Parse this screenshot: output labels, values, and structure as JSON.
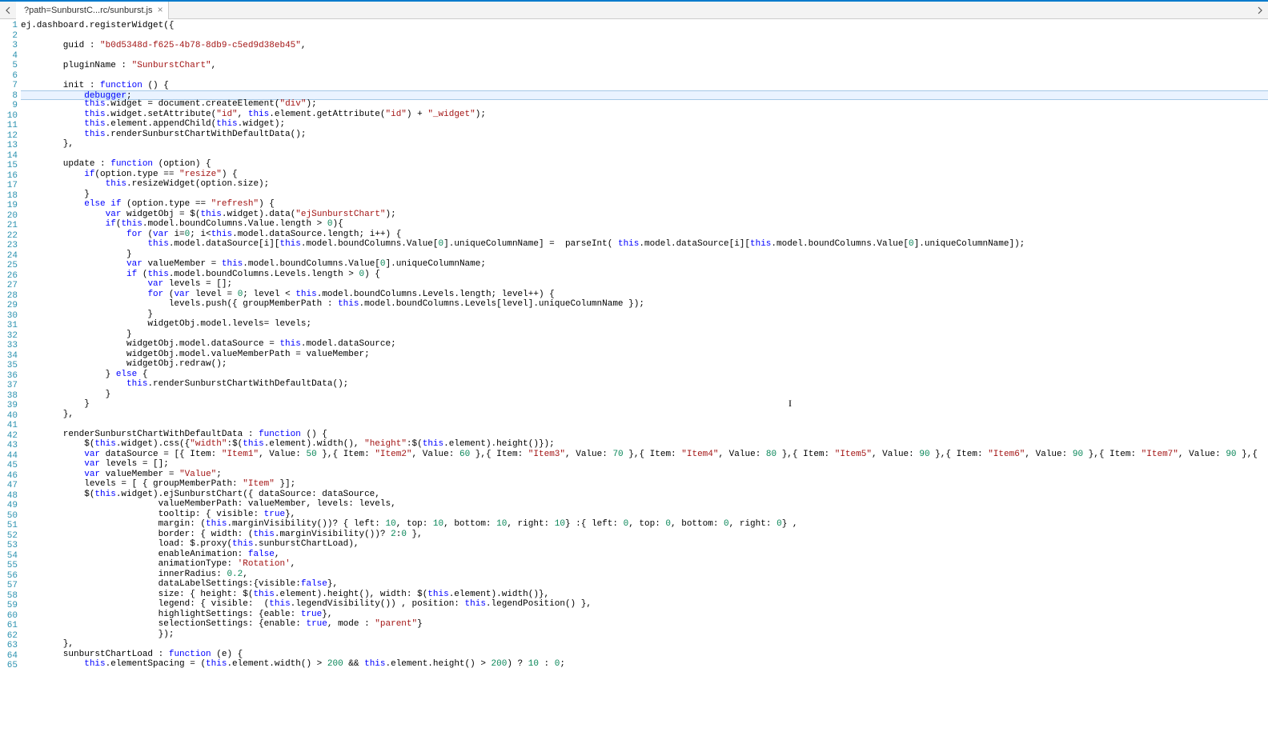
{
  "tab": {
    "title": "?path=SunburstC...rc/sunburst.js",
    "close_glyph": "×"
  },
  "line_numbers": [
    "1",
    "2",
    "3",
    "4",
    "5",
    "6",
    "7",
    "8",
    "9",
    "10",
    "11",
    "12",
    "13",
    "14",
    "15",
    "16",
    "17",
    "18",
    "19",
    "20",
    "21",
    "22",
    "23",
    "24",
    "25",
    "26",
    "27",
    "28",
    "29",
    "30",
    "31",
    "32",
    "33",
    "34",
    "35",
    "36",
    "37",
    "38",
    "39",
    "40",
    "41",
    "42",
    "43",
    "44",
    "45",
    "46",
    "47",
    "48",
    "49",
    "50",
    "51",
    "52",
    "53",
    "54",
    "55",
    "56",
    "57",
    "58",
    "59",
    "60",
    "61",
    "62",
    "63",
    "64",
    "65"
  ],
  "code_lines": [
    {
      "t": "ej.dashboard.registerWidget({"
    },
    {
      "t": ""
    },
    {
      "t": "        guid : \"b0d5348d-f625-4b78-8db9-c5ed9d38eb45\","
    },
    {
      "t": ""
    },
    {
      "t": "        pluginName : \"SunburstChart\","
    },
    {
      "t": ""
    },
    {
      "t": "        init : function () {"
    },
    {
      "t": "            debugger;",
      "hl": true
    },
    {
      "t": "            this.widget = document.createElement(\"div\");"
    },
    {
      "t": "            this.widget.setAttribute(\"id\", this.element.getAttribute(\"id\") + \"_widget\");"
    },
    {
      "t": "            this.element.appendChild(this.widget);"
    },
    {
      "t": "            this.renderSunburstChartWithDefaultData();"
    },
    {
      "t": "        },"
    },
    {
      "t": ""
    },
    {
      "t": "        update : function (option) {"
    },
    {
      "t": "            if(option.type == \"resize\") {"
    },
    {
      "t": "                this.resizeWidget(option.size);"
    },
    {
      "t": "            }"
    },
    {
      "t": "            else if (option.type == \"refresh\") {"
    },
    {
      "t": "                var widgetObj = $(this.widget).data(\"ejSunburstChart\");"
    },
    {
      "t": "                if(this.model.boundColumns.Value.length > 0){"
    },
    {
      "t": "                    for (var i=0; i<this.model.dataSource.length; i++) {"
    },
    {
      "t": "                        this.model.dataSource[i][this.model.boundColumns.Value[0].uniqueColumnName] =  parseInt( this.model.dataSource[i][this.model.boundColumns.Value[0].uniqueColumnName]);"
    },
    {
      "t": "                    }"
    },
    {
      "t": "                    var valueMember = this.model.boundColumns.Value[0].uniqueColumnName;"
    },
    {
      "t": "                    if (this.model.boundColumns.Levels.length > 0) {"
    },
    {
      "t": "                        var levels = [];"
    },
    {
      "t": "                        for (var level = 0; level < this.model.boundColumns.Levels.length; level++) {"
    },
    {
      "t": "                            levels.push({ groupMemberPath : this.model.boundColumns.Levels[level].uniqueColumnName });"
    },
    {
      "t": "                        }"
    },
    {
      "t": "                        widgetObj.model.levels= levels;"
    },
    {
      "t": "                    }"
    },
    {
      "t": "                    widgetObj.model.dataSource = this.model.dataSource;"
    },
    {
      "t": "                    widgetObj.model.valueMemberPath = valueMember;"
    },
    {
      "t": "                    widgetObj.redraw();"
    },
    {
      "t": "                } else {"
    },
    {
      "t": "                    this.renderSunburstChartWithDefaultData();"
    },
    {
      "t": "                }"
    },
    {
      "t": "            }"
    },
    {
      "t": "        },"
    },
    {
      "t": ""
    },
    {
      "t": "        renderSunburstChartWithDefaultData : function () {"
    },
    {
      "t": "            $(this.widget).css({\"width\":$(this.element).width(), \"height\":$(this.element).height()});"
    },
    {
      "t": "            var dataSource = [{ Item: \"Item1\", Value: 50 },{ Item: \"Item2\", Value: 60 },{ Item: \"Item3\", Value: 70 },{ Item: \"Item4\", Value: 80 },{ Item: \"Item5\", Value: 90 },{ Item: \"Item6\", Value: 90 },{ Item: \"Item7\", Value: 90 },{"
    },
    {
      "t": "            var levels = [];"
    },
    {
      "t": "            var valueMember = \"Value\";"
    },
    {
      "t": "            levels = [ { groupMemberPath: \"Item\" }];"
    },
    {
      "t": "            $(this.widget).ejSunburstChart({ dataSource: dataSource,"
    },
    {
      "t": "                          valueMemberPath: valueMember, levels: levels,"
    },
    {
      "t": "                          tooltip: { visible: true},"
    },
    {
      "t": "                          margin: (this.marginVisibility())? { left: 10, top: 10, bottom: 10, right: 10} :{ left: 0, top: 0, bottom: 0, right: 0} ,"
    },
    {
      "t": "                          border: { width: (this.marginVisibility())? 2:0 },"
    },
    {
      "t": "                          load: $.proxy(this.sunburstChartLoad),"
    },
    {
      "t": "                          enableAnimation: false,"
    },
    {
      "t": "                          animationType: 'Rotation',"
    },
    {
      "t": "                          innerRadius: 0.2,"
    },
    {
      "t": "                          dataLabelSettings:{visible:false},"
    },
    {
      "t": "                          size: { height: $(this.element).height(), width: $(this.element).width()},"
    },
    {
      "t": "                          legend: { visible:  (this.legendVisibility()) , position: this.legendPosition() },"
    },
    {
      "t": "                          highlightSettings: {eable: true},"
    },
    {
      "t": "                          selectionSettings: {enable: true, mode : \"parent\"}"
    },
    {
      "t": "                          });"
    },
    {
      "t": "        },"
    },
    {
      "t": "        sunburstChartLoad : function (e) {"
    },
    {
      "t": "            this.elementSpacing = (this.element.width() > 200 && this.element.height() > 200) ? 10 : 0;"
    }
  ],
  "keywords": [
    "function",
    "var",
    "this",
    "if",
    "else",
    "for",
    "true",
    "false",
    "debugger"
  ],
  "cursor_glyph": "I"
}
